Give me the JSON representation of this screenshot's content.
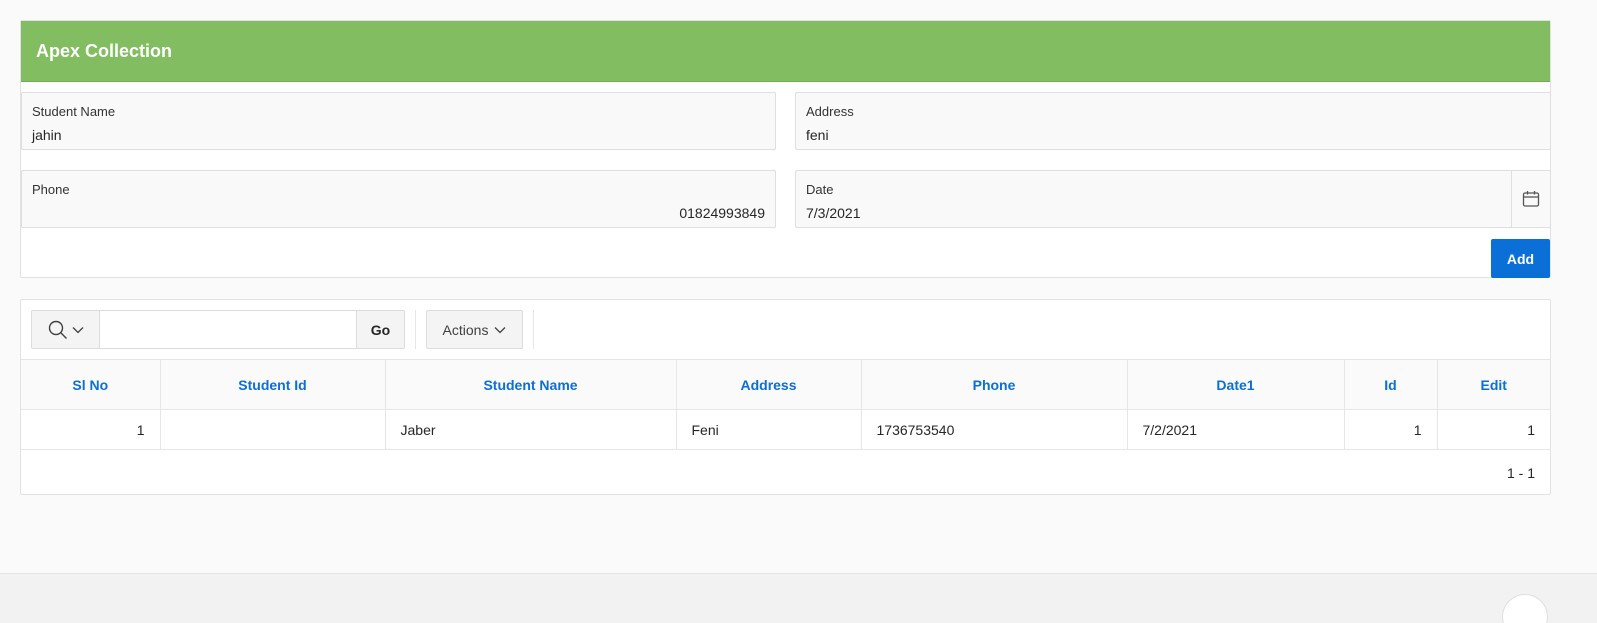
{
  "form": {
    "title": "Apex Collection",
    "student_name": {
      "label": "Student Name",
      "value": "jahin"
    },
    "address": {
      "label": "Address",
      "value": "feni"
    },
    "phone": {
      "label": "Phone",
      "value": "01824993849"
    },
    "date": {
      "label": "Date",
      "value": "7/3/2021"
    },
    "add_label": "Add"
  },
  "report": {
    "go_label": "Go",
    "actions_label": "Actions",
    "search_value": "",
    "columns": [
      "Sl No",
      "Student Id",
      "Student Name",
      "Address",
      "Phone",
      "Date1",
      "Id",
      "Edit"
    ],
    "rows": [
      {
        "sl_no": "1",
        "student_id": "",
        "student_name": "Jaber",
        "address": "Feni",
        "phone": "1736753540",
        "date1": "7/2/2021",
        "id": "1",
        "edit": "1"
      }
    ],
    "pagination": "1 - 1"
  },
  "colors": {
    "header_green": "#82bd61",
    "accent_blue": "#0a6fd6"
  }
}
